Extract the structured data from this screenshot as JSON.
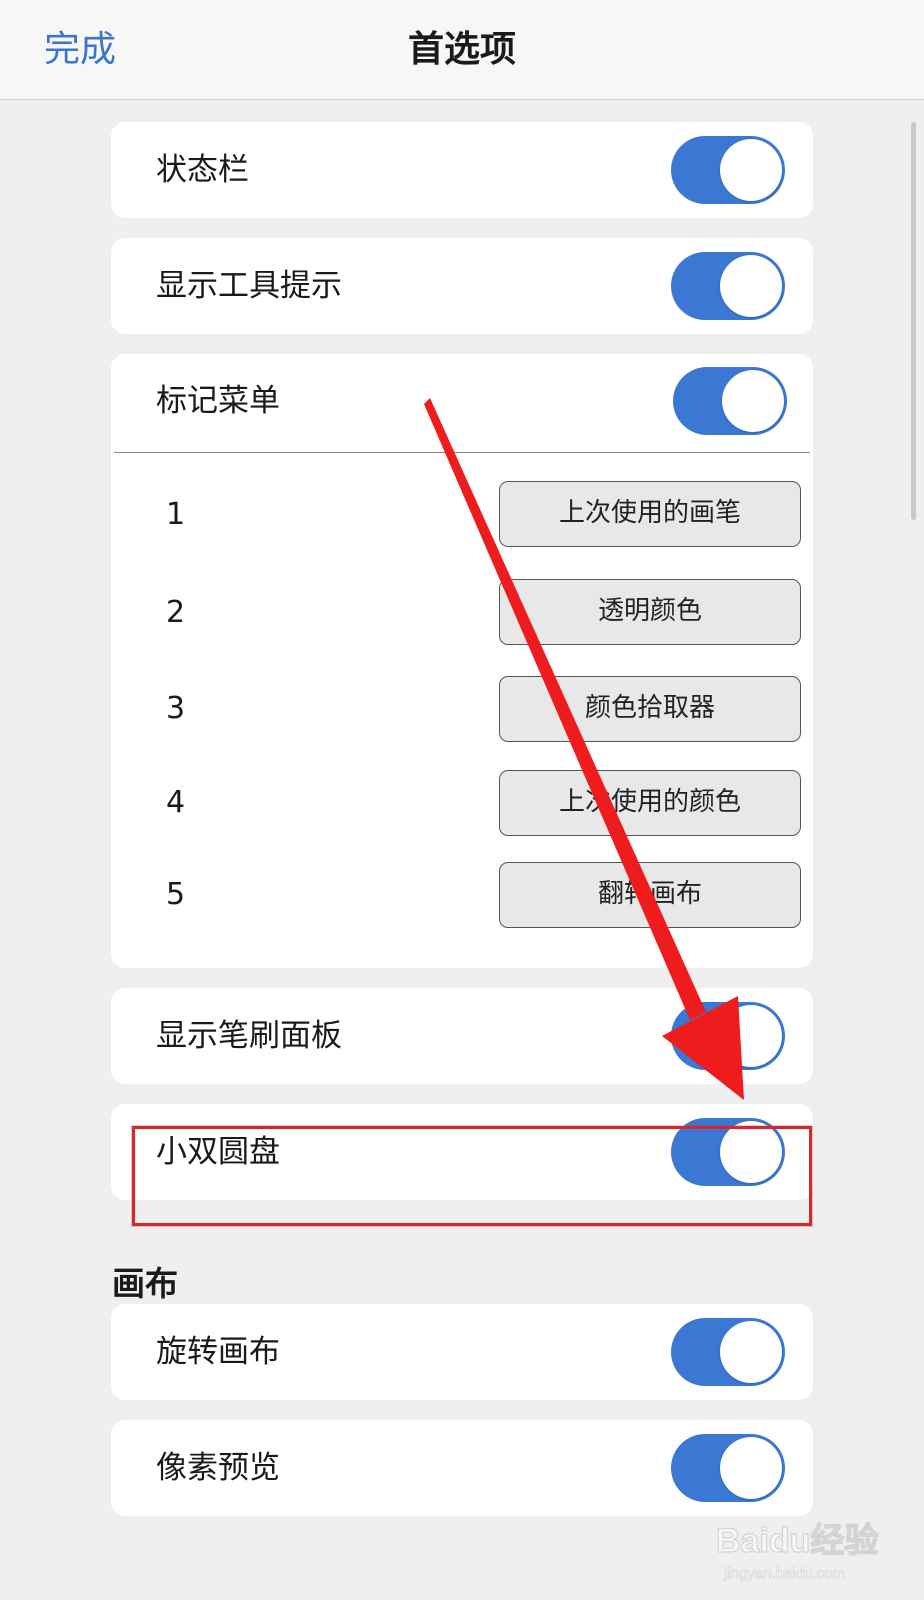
{
  "nav": {
    "done_label": "完成",
    "title": "首选项"
  },
  "status_bar_row": {
    "label": "状态栏",
    "on": true
  },
  "tooltips_row": {
    "label": "显示工具提示",
    "on": true
  },
  "mark_menu": {
    "label": "标记菜单",
    "on": true,
    "slots": [
      {
        "number": "1",
        "action": "上次使用的画笔"
      },
      {
        "number": "2",
        "action": "透明颜色"
      },
      {
        "number": "3",
        "action": "颜色拾取器"
      },
      {
        "number": "4",
        "action": "上次使用的颜色"
      },
      {
        "number": "5",
        "action": "翻转画布"
      }
    ]
  },
  "brush_panel_row": {
    "label": "显示笔刷面板",
    "on": true
  },
  "dual_puck_row": {
    "label": "小双圆盘",
    "on": true
  },
  "canvas_section": {
    "header": "画布",
    "rotate_row": {
      "label": "旋转画布",
      "on": true
    },
    "pixel_preview_row": {
      "label": "像素预览",
      "on": true
    }
  },
  "colors": {
    "accent": "#3a76cf",
    "toggle_on": "#3a78d4",
    "highlight": "#d9262b",
    "arrow": "#ee1c1c"
  },
  "watermark": {
    "brand": "Baidu经验",
    "url": "jingyan.baidu.com"
  }
}
